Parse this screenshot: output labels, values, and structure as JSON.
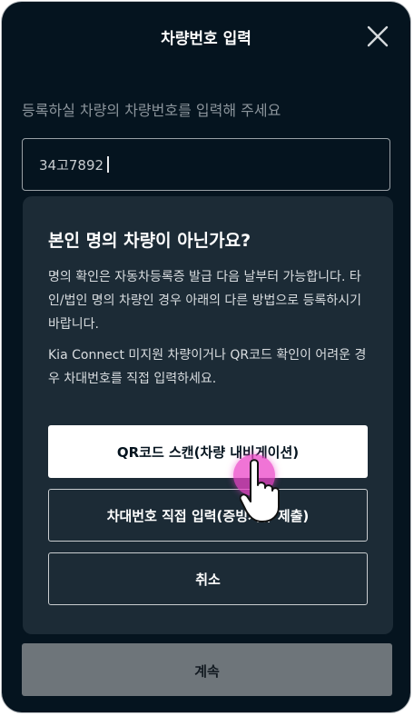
{
  "header": {
    "title": "차량번호 입력",
    "close_icon": "close-icon"
  },
  "instruction": "등록하실 차량의 차량번호를 입력해 주세요",
  "plate_input": {
    "value": "34고7892"
  },
  "continue_button": {
    "label": "계속"
  },
  "dialog": {
    "title": "본인 명의 차량이 아닌가요?",
    "body_paragraph_1": "명의 확인은 자동차등록증 발급 다음 날부터 가능합니다. 타인/법인 명의 차량인 경우 아래의 다른 방법으로 등록하시기 바랍니다.",
    "body_paragraph_2": "Kia Connect 미지원 차량이거나 QR코드 확인이 어려운 경우 차대번호를 직접 입력하세요.",
    "buttons": {
      "qr_scan": "QR코드 스캔(차량 내비게이션)",
      "vin_input": "차대번호 직접 입력(증빙서류 제출)",
      "cancel": "취소"
    }
  },
  "colors": {
    "background": "#05141f",
    "dialog": "#1c2b36",
    "tap_indicator": "#eb46c8"
  },
  "icons": {
    "pointer": "hand-pointer-icon"
  }
}
